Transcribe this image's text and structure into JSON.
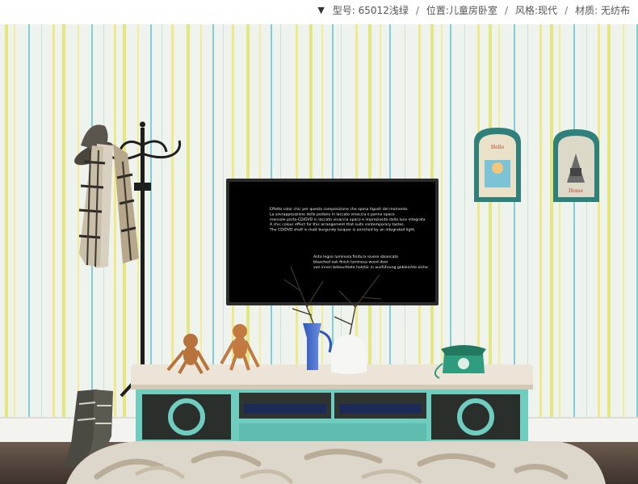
{
  "spec_bar": {
    "arrow_icon": "triangle-down-icon",
    "items": [
      {
        "label": "型号:",
        "value": "65012浅绿"
      },
      {
        "label": "位置:",
        "value": "儿童房卧室"
      },
      {
        "label": "风格:",
        "value": "现代"
      },
      {
        "label": "材质:",
        "value": "无纺布"
      }
    ],
    "separator": "/"
  },
  "tv_screen": {
    "block1": [
      "Effetto color chic per questa composizione che sposa tigusti del momento.",
      "La sovrapposizione delle pedane in laccato vinaccia e panna opaco",
      "mensole porta-CD/DVD in laccato vinaccia opaco e impreziosita dalla luce integrata",
      "A chic colour effect for this arrangement that suits contemporary tastes.",
      "The CD/DVD shelf in matt burgundy lacquer is enriched by an integrated light."
    ],
    "block2": [
      "Anta legno luminosa finitura rovere sbiancato",
      "bleached oak finish luminous wood door",
      "von innen beleuchtete holztür in ausführung gebleichte eiche"
    ]
  },
  "frames": [
    {
      "caption": "Hello"
    },
    {
      "caption": "Home"
    }
  ],
  "colors": {
    "wall": "#eef3ee",
    "stripe_yellow": "#e3e46a",
    "stripe_teal": "#6fc6d2",
    "cabinet": "#6fcdbf",
    "top": "#ece5d7",
    "floor": "#5a4a40"
  }
}
